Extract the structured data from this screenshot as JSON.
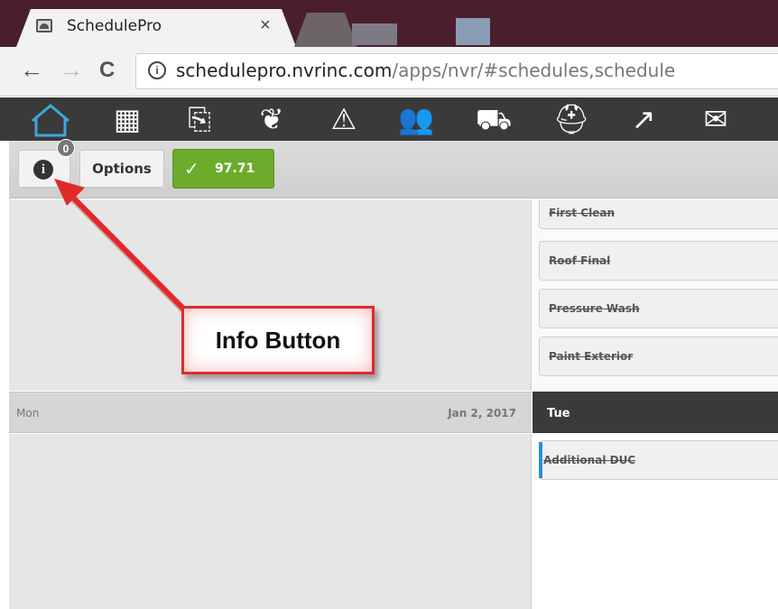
{
  "browser": {
    "tab_title": "SchedulePro",
    "tab_close": "×",
    "url_host": "schedulepro.nvrinc.com",
    "url_path": "/apps/nvr/#schedules,schedule",
    "back_glyph": "←",
    "forward_glyph": "→",
    "reload_glyph": "C",
    "info_glyph": "i"
  },
  "toolbar": {
    "icons": [
      "home-icon",
      "calendar-icon",
      "documents-icon",
      "leaf-icon",
      "warning-icon",
      "people-icon",
      "delivery-truck-icon",
      "hard-hat-icon",
      "growth-chart-icon",
      "mail-icon"
    ],
    "glyphs": {
      "calendar": "▦",
      "documents": "⎘",
      "leaf": "❦",
      "warning": "⚠",
      "people": "👥",
      "truck": "⛟",
      "hat": "⛑",
      "chart": "↗",
      "mail": "✉"
    }
  },
  "actions": {
    "info_badge": "0",
    "info_glyph": "i",
    "options_label": "Options",
    "score_check": "✓",
    "score_value": "97.71"
  },
  "tasks_top": [
    "First Clean",
    "Roof Final",
    "Pressure Wash",
    "Paint Exterior"
  ],
  "days": {
    "left_day": "Mon",
    "left_date": "Jan 2, 2017",
    "right_day": "Tue"
  },
  "tasks_bottom": [
    "Additional DUC"
  ],
  "annotation": {
    "label": "Info Button"
  },
  "colors": {
    "accent_green": "#6cab2c",
    "annotation_red": "#e02a2a",
    "toolbar_dark": "#3a3a3a",
    "home_accent": "#3ea7dc"
  }
}
